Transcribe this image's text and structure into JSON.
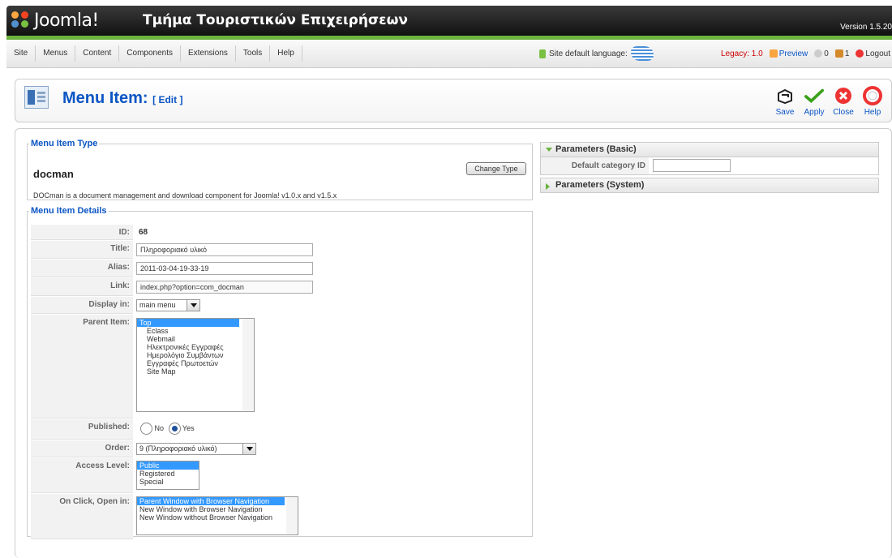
{
  "header": {
    "logo_text": "Joomla!",
    "site_title": "Τμήμα Τουριστικών Επιχειρήσεων",
    "version": "Version 1.5.20"
  },
  "menu": [
    "Site",
    "Menus",
    "Content",
    "Components",
    "Extensions",
    "Tools",
    "Help"
  ],
  "status": {
    "site_default_language": "Site default language:",
    "legacy": "Legacy: 1.0",
    "preview": "Preview",
    "messages": "0",
    "users_online": "1",
    "logout": "Logout"
  },
  "toolbar": {
    "title": "Menu Item:",
    "subtitle": "[ Edit ]",
    "save": "Save",
    "apply": "Apply",
    "close": "Close",
    "help": "Help"
  },
  "type_section": {
    "legend": "Menu Item Type",
    "name": "docman",
    "change_button": "Change Type",
    "description": "DOCman is a document management and download component for Joomla! v1.0.x and v1.5.x"
  },
  "details": {
    "legend": "Menu Item Details",
    "id_label": "ID:",
    "id_value": "68",
    "title_label": "Title:",
    "title_value": "Πληροφοριακό υλικό",
    "alias_label": "Alias:",
    "alias_value": "2011-03-04-19-33-19",
    "link_label": "Link:",
    "link_value": "index.php?option=com_docman",
    "display_label": "Display in:",
    "display_value": "main menu",
    "parent_label": "Parent Item:",
    "parent_items": [
      "Top",
      "Eclass",
      "Webmail",
      "Ηλεκτρονικές Εγγραφές",
      "Ημερολόγιο Συμβάντων",
      "Εγγραφές Πρωτοετών",
      "Site Map"
    ],
    "published_label": "Published:",
    "published_no": "No",
    "published_yes": "Yes",
    "order_label": "Order:",
    "order_value": "9 (Πληροφοριακό υλικό)",
    "access_label": "Access Level:",
    "access_options": [
      "Public",
      "Registered",
      "Special"
    ],
    "onclick_label": "On Click, Open in:",
    "onclick_options": [
      "Parent Window with Browser Navigation",
      "New Window with Browser Navigation",
      "New Window without Browser Navigation"
    ]
  },
  "params": {
    "basic_title": "Parameters (Basic)",
    "default_category_label": "Default category ID",
    "default_category_value": "",
    "system_title": "Parameters (System)"
  }
}
